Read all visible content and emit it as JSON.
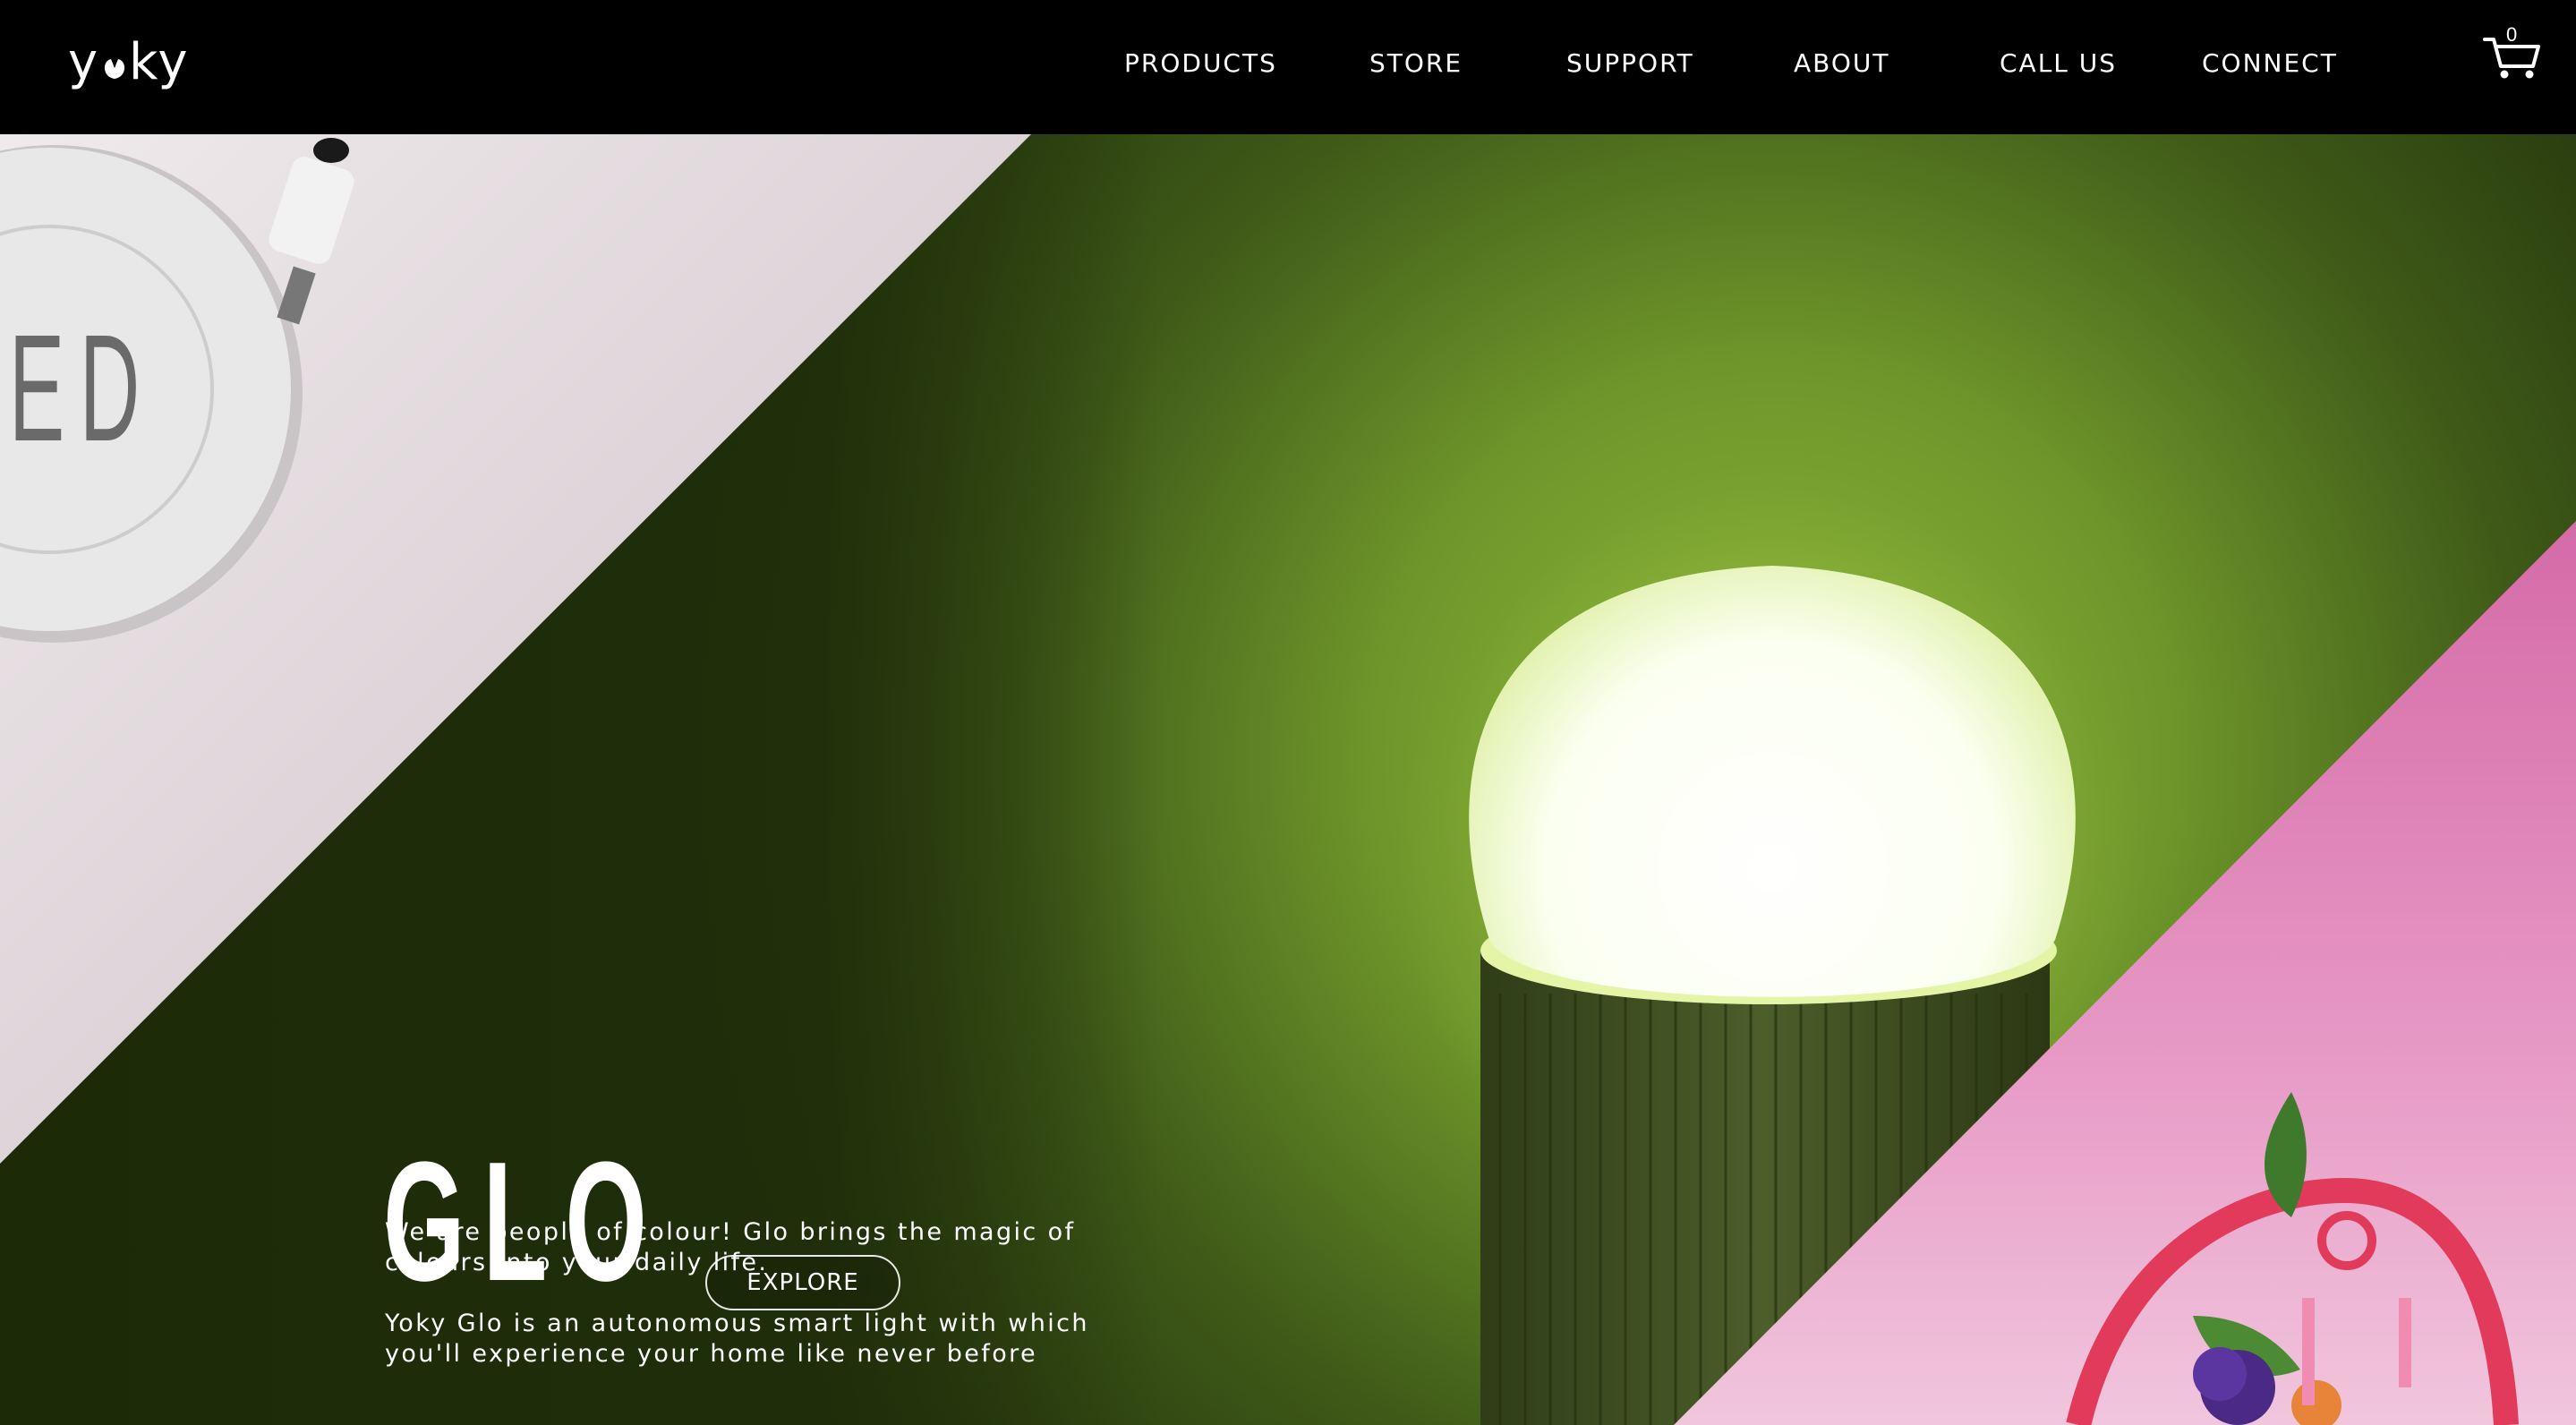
{
  "brand": {
    "logo_text": "yoky"
  },
  "nav": {
    "items": [
      {
        "label": "PRODUCTS"
      },
      {
        "label": "STORE"
      },
      {
        "label": "SUPPORT"
      },
      {
        "label": "ABOUT"
      },
      {
        "label": "CALL US"
      },
      {
        "label": "CONNECT"
      }
    ],
    "cart_count": "0",
    "cart_icon": "shopping-cart-icon"
  },
  "hero": {
    "title": "GLO",
    "explore_label": "EXPLORE",
    "paragraph_1": "We are people of colour! Glo brings the magic of colours into your daily life.",
    "paragraph_2": "Yoky Glo is an autonomous smart light with which you'll experience your home like never before",
    "product_panel_lettering": "ED"
  },
  "colors": {
    "nav_bg": "#000000",
    "hero_green": "#6f9a2a",
    "hero_dark": "#1f2e0a",
    "panel_left": "#d9cfd3",
    "panel_right": "#e58fc0"
  }
}
